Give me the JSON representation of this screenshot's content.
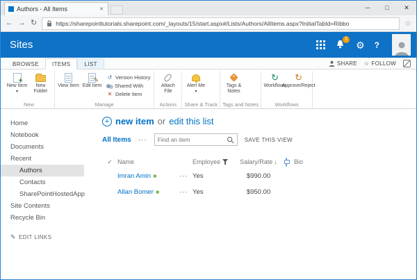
{
  "icons": {
    "check": "✓",
    "caret_down": "▾",
    "sort_desc": "↓",
    "gear": "⚙",
    "help": "?",
    "star_outline": "☆",
    "pencil": "✎",
    "plus": "+",
    "new_badge": "✱",
    "back_arrow": "←",
    "forward_arrow": "→",
    "refresh": "↻",
    "version_history": "↺",
    "delete_x": "✕",
    "minimize": "─",
    "maximize": "□",
    "close_x": "✕"
  },
  "colors": {
    "suite_bar": "#0e72c6",
    "accent_link": "#0072c6",
    "notification_badge": "#f59b00",
    "new_badge_green": "#6aa834"
  },
  "browser": {
    "tab_title": "Authors - All Items",
    "url": "https://sharepointtutorials.sharepoint.com/_layouts/15/start.aspx#/Lists/Authors/AllItems.aspx?InitialTabId=Ribbo"
  },
  "suite_bar": {
    "title": "Sites",
    "notification_count": "1"
  },
  "ribbon_tabs": {
    "browse": "BROWSE",
    "items": "ITEMS",
    "list": "LIST",
    "share": "SHARE",
    "follow": "FOLLOW"
  },
  "ribbon": {
    "groups": [
      {
        "label": "New",
        "buttons": [
          {
            "label": "New Item"
          },
          {
            "label": "New Folder"
          }
        ]
      },
      {
        "label": "Manage",
        "buttons": [
          {
            "label": "View Item"
          },
          {
            "label": "Edit Item"
          }
        ],
        "small_buttons": [
          {
            "label": "Version History"
          },
          {
            "label": "Shared With"
          },
          {
            "label": "Delete Item"
          }
        ]
      },
      {
        "label": "Actions",
        "buttons": [
          {
            "label": "Attach File"
          }
        ]
      },
      {
        "label": "Share & Track",
        "buttons": [
          {
            "label": "Alert Me"
          }
        ]
      },
      {
        "label": "Tags and Notes",
        "buttons": [
          {
            "label": "Tags & Notes"
          }
        ]
      },
      {
        "label": "Workflows",
        "buttons": [
          {
            "label": "Workflows"
          },
          {
            "label": "Approve/Reject"
          }
        ]
      }
    ]
  },
  "sidebar": {
    "items": [
      {
        "label": "Home"
      },
      {
        "label": "Notebook"
      },
      {
        "label": "Documents"
      },
      {
        "label": "Recent"
      },
      {
        "label": "Authors"
      },
      {
        "label": "Contacts"
      },
      {
        "label": "SharePointHostedApp"
      },
      {
        "label": "Site Contents"
      },
      {
        "label": "Recycle Bin"
      }
    ],
    "edit_links": "EDIT LINKS"
  },
  "main": {
    "heading": {
      "new_item": "new item",
      "or": "or",
      "edit_list": "edit this list"
    },
    "toolbar": {
      "view_name": "All Items",
      "ellipsis": "···",
      "search_placeholder": "Find an item",
      "save_view": "SAVE THIS VIEW"
    },
    "table": {
      "headers": {
        "name": "Name",
        "employee": "Employee",
        "salary": "Salary/Rate",
        "bio": "Bio"
      },
      "rows": [
        {
          "name": "Imran Amin",
          "ellipsis": "···",
          "employee": "Yes",
          "salary": "$990.00"
        },
        {
          "name": "Allan Bomer",
          "ellipsis": "···",
          "employee": "Yes",
          "salary": "$950.00"
        }
      ]
    }
  }
}
